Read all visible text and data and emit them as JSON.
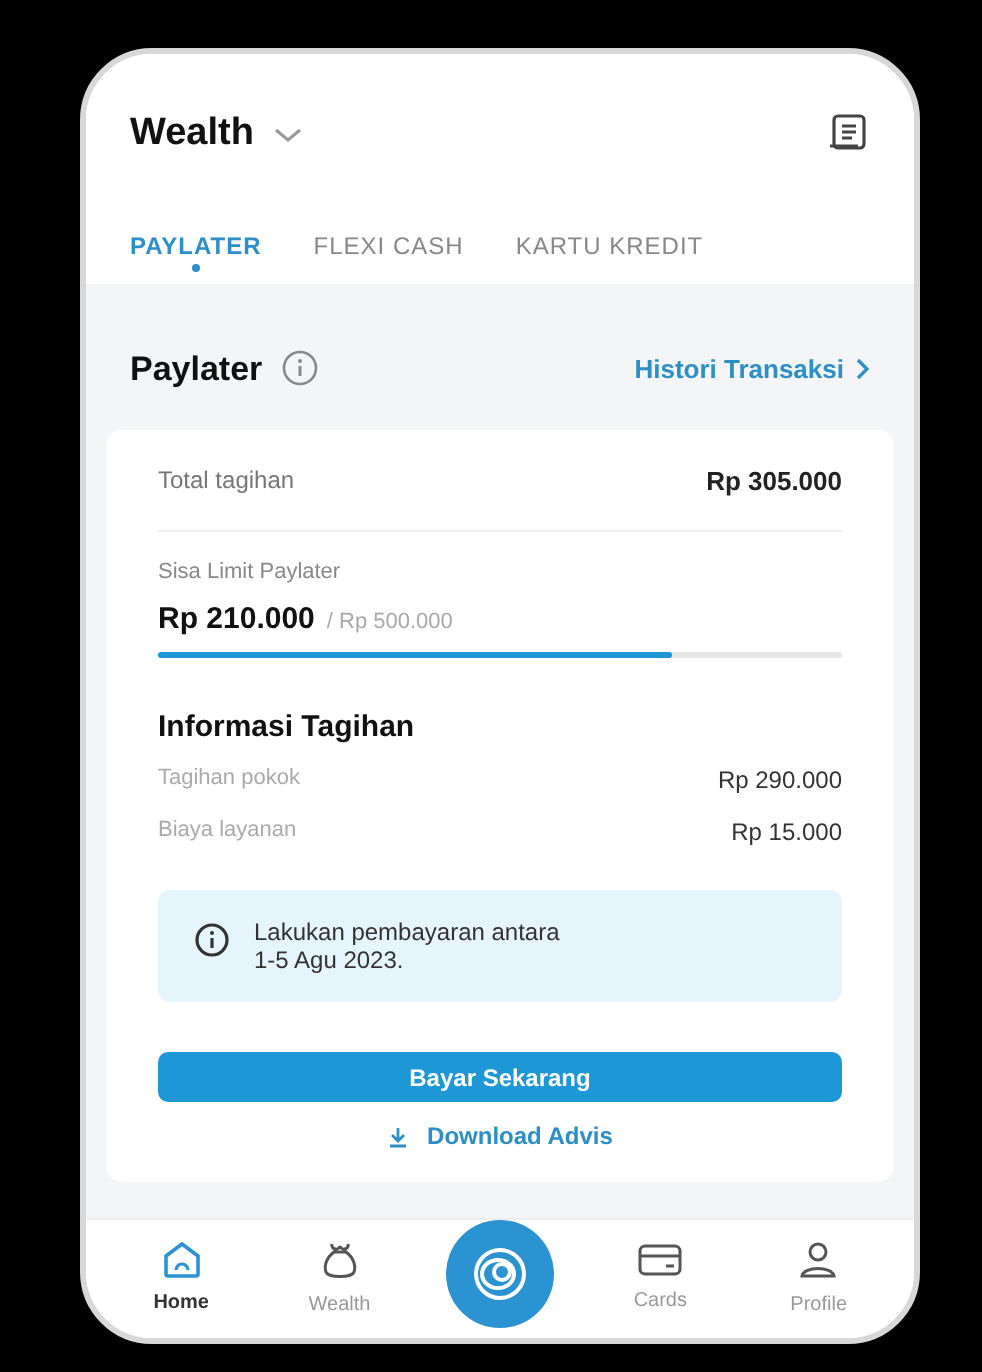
{
  "header": {
    "title": "Wealth"
  },
  "tabs": [
    {
      "label": "PAYLATER",
      "selected": true
    },
    {
      "label": "FLEXI CASH",
      "selected": false
    },
    {
      "label": "KARTU KREDIT",
      "selected": false
    }
  ],
  "section": {
    "title": "Paylater",
    "link": "Histori Transaksi"
  },
  "card": {
    "total_label": "Total tagihan",
    "total_value": "Rp 305.000",
    "limit": {
      "label": "Sisa Limit Paylater",
      "remaining": "Rp 210.000",
      "max": "/ Rp 500.000",
      "level": 0.75
    },
    "info_title": "Informasi Tagihan",
    "lines": [
      {
        "label": "Tagihan pokok",
        "value": "Rp 290.000"
      },
      {
        "label": "Biaya layanan",
        "value": "Rp 15.000"
      }
    ],
    "notice": [
      "Lakukan pembayaran antara",
      "1-5 Agu 2023."
    ],
    "pay_button": "Bayar Sekarang",
    "download_link": "Download Advis"
  },
  "nav": [
    {
      "kind": "home",
      "label": "Home",
      "selected": true
    },
    {
      "kind": "wealth",
      "label": "Wealth",
      "selected": false
    },
    {
      "kind": "center"
    },
    {
      "kind": "cards",
      "label": "Cards",
      "selected": false
    },
    {
      "kind": "profile",
      "label": "Profile",
      "selected": false
    }
  ]
}
